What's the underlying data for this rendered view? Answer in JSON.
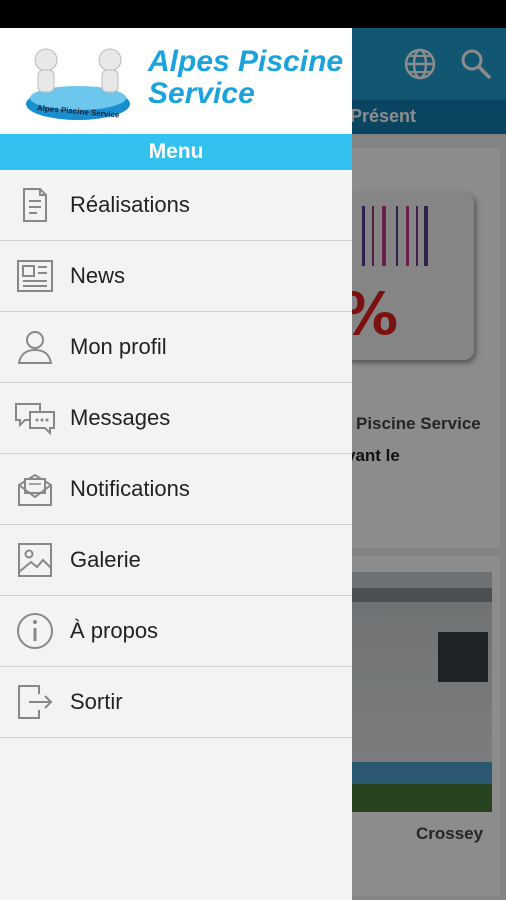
{
  "brand": {
    "line1": "Alpes Piscine",
    "line2": "Service",
    "logo_text": "Alpes Piscine Service"
  },
  "drawer": {
    "menu_title": "Menu",
    "items": [
      {
        "label": "Réalisations",
        "icon": "document-icon"
      },
      {
        "label": "News",
        "icon": "newspaper-icon"
      },
      {
        "label": "Mon profil",
        "icon": "user-icon"
      },
      {
        "label": "Messages",
        "icon": "chat-icon"
      },
      {
        "label": "Notifications",
        "icon": "envelope-icon"
      },
      {
        "label": "Galerie",
        "icon": "image-icon"
      },
      {
        "label": "À propos",
        "icon": "info-icon"
      },
      {
        "label": "Sortir",
        "icon": "exit-icon"
      }
    ]
  },
  "background": {
    "tab_label": "Présent",
    "card1_title": "Piscine Service",
    "card1_subtitle": "vant le",
    "card2_title": "Crossey"
  },
  "colors": {
    "accent": "#33c2f0",
    "appbar": "#1f9fd0",
    "brand_text": "#1aa3dc"
  }
}
